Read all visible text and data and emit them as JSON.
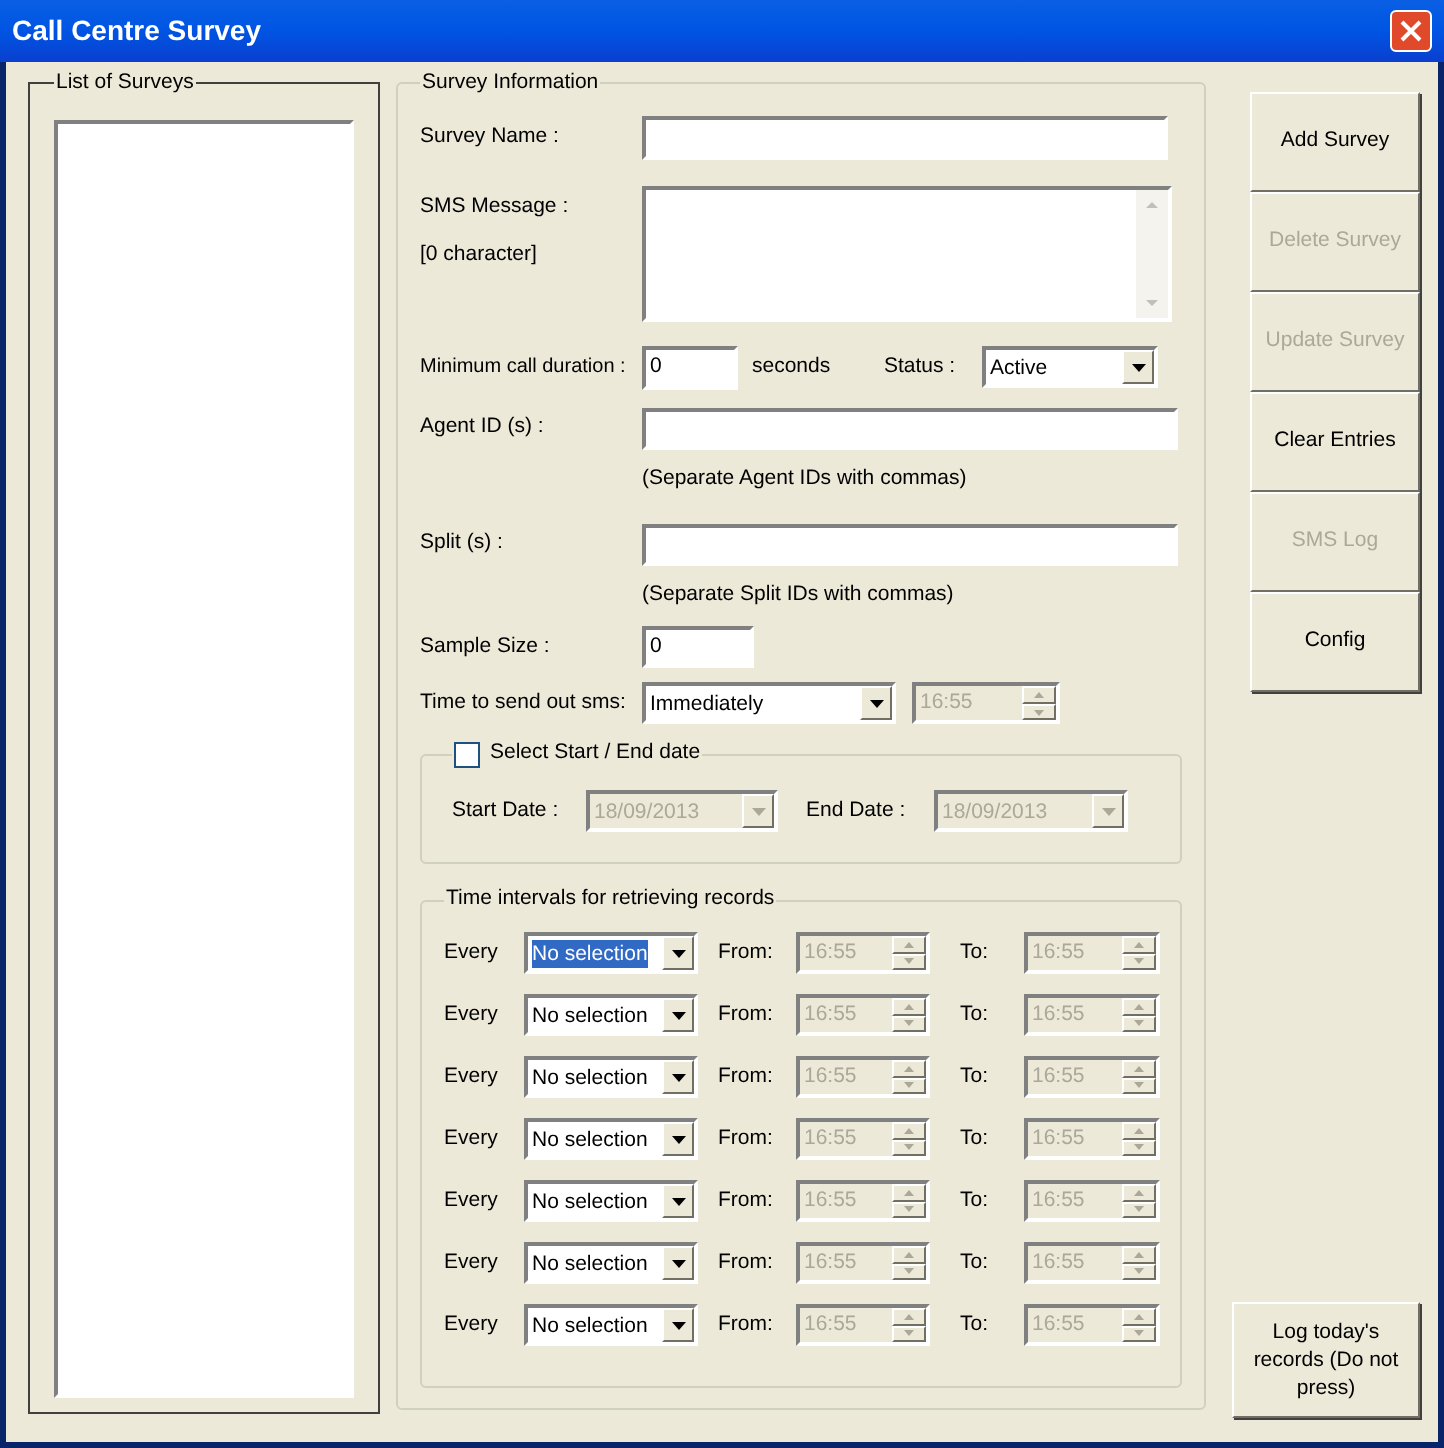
{
  "window": {
    "title": "Call Centre Survey"
  },
  "survey_list": {
    "title": "List of Surveys"
  },
  "survey_information": {
    "title": "Survey Information",
    "survey_name": {
      "label": "Survey Name :"
    },
    "sms_message": {
      "label": "SMS Message :",
      "counter": "[0 character]"
    },
    "minimum_call_duration": {
      "label": "Minimum call duration :",
      "value": "0",
      "unit": "seconds"
    },
    "status": {
      "label": "Status :",
      "value": "Active"
    },
    "agent_ids": {
      "label": "Agent ID (s) :",
      "hint": "(Separate Agent IDs with commas)"
    },
    "splits": {
      "label": "Split (s) :",
      "hint": "(Separate Split IDs with commas)"
    },
    "sample_size": {
      "label": "Sample Size :",
      "value": "0"
    },
    "send_time": {
      "label": "Time to send out sms:",
      "value": "Immediately",
      "time": "16:55",
      "time_disabled": true
    },
    "date_range": {
      "label": "Select Start / End date",
      "checked": false,
      "disabled": true,
      "start_label": "Start Date :",
      "start_value": "18/09/2013",
      "end_label": "End Date :",
      "end_value": "18/09/2013"
    },
    "intervals": {
      "title": "Time intervals for retrieving records",
      "rows": [
        {
          "every_label": "Every",
          "value": "No selection",
          "selected": true,
          "from_label": "From:",
          "from": "16:55",
          "to_label": "To:",
          "to": "16:55",
          "disabled": true
        },
        {
          "every_label": "Every",
          "value": "No selection",
          "selected": false,
          "from_label": "From:",
          "from": "16:55",
          "to_label": "To:",
          "to": "16:55",
          "disabled": true
        },
        {
          "every_label": "Every",
          "value": "No selection",
          "selected": false,
          "from_label": "From:",
          "from": "16:55",
          "to_label": "To:",
          "to": "16:55",
          "disabled": true
        },
        {
          "every_label": "Every",
          "value": "No selection",
          "selected": false,
          "from_label": "From:",
          "from": "16:55",
          "to_label": "To:",
          "to": "16:55",
          "disabled": true
        },
        {
          "every_label": "Every",
          "value": "No selection",
          "selected": false,
          "from_label": "From:",
          "from": "16:55",
          "to_label": "To:",
          "to": "16:55",
          "disabled": true
        },
        {
          "every_label": "Every",
          "value": "No selection",
          "selected": false,
          "from_label": "From:",
          "from": "16:55",
          "to_label": "To:",
          "to": "16:55",
          "disabled": true
        },
        {
          "every_label": "Every",
          "value": "No selection",
          "selected": false,
          "from_label": "From:",
          "from": "16:55",
          "to_label": "To:",
          "to": "16:55",
          "disabled": true
        }
      ]
    }
  },
  "buttons": [
    {
      "label": "Add Survey",
      "disabled": false
    },
    {
      "label": "Delete Survey",
      "disabled": true
    },
    {
      "label": "Update Survey",
      "disabled": true
    },
    {
      "label": "Clear Entries",
      "disabled": false
    },
    {
      "label": "SMS Log",
      "disabled": true
    },
    {
      "label": "Config",
      "disabled": false
    }
  ],
  "log_button": {
    "label": "Log today's records (Do not press)",
    "disabled": false
  }
}
